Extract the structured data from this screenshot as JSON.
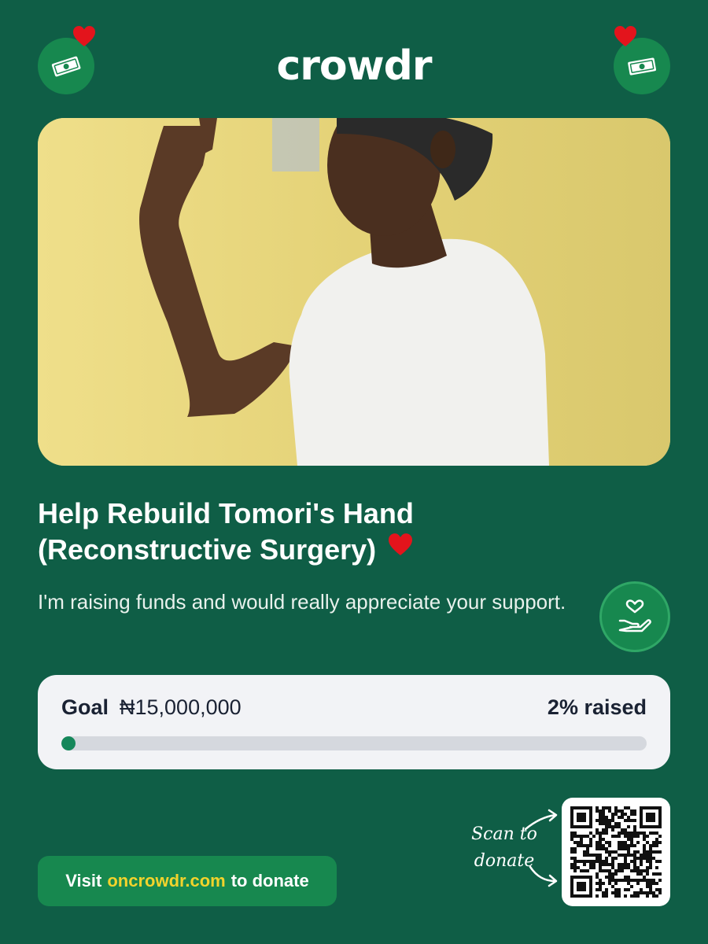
{
  "brand": {
    "name": "crowdr",
    "primary_bg": "#0f5e46",
    "accent_green": "#17884f",
    "heart_red": "#e3141c",
    "link_yellow": "#f2d32c"
  },
  "icons": {
    "left_badge": "money-bill-icon",
    "right_badge": "money-bill-icon",
    "support_badge": "hand-heart-icon"
  },
  "campaign": {
    "title_line1": "Help Rebuild Tomori's Hand",
    "title_line2": "(Reconstructive Surgery)",
    "subtitle": "I'm raising funds and would really appreciate your support."
  },
  "goal": {
    "label": "Goal",
    "amount": "₦15,000,000",
    "raised_text": "2% raised",
    "progress_fraction": 0.02
  },
  "cta": {
    "prefix": "Visit",
    "url": "oncrowdr.com",
    "suffix": "to donate"
  },
  "qr": {
    "note_line1": "Scan to",
    "note_line2": "donate"
  }
}
